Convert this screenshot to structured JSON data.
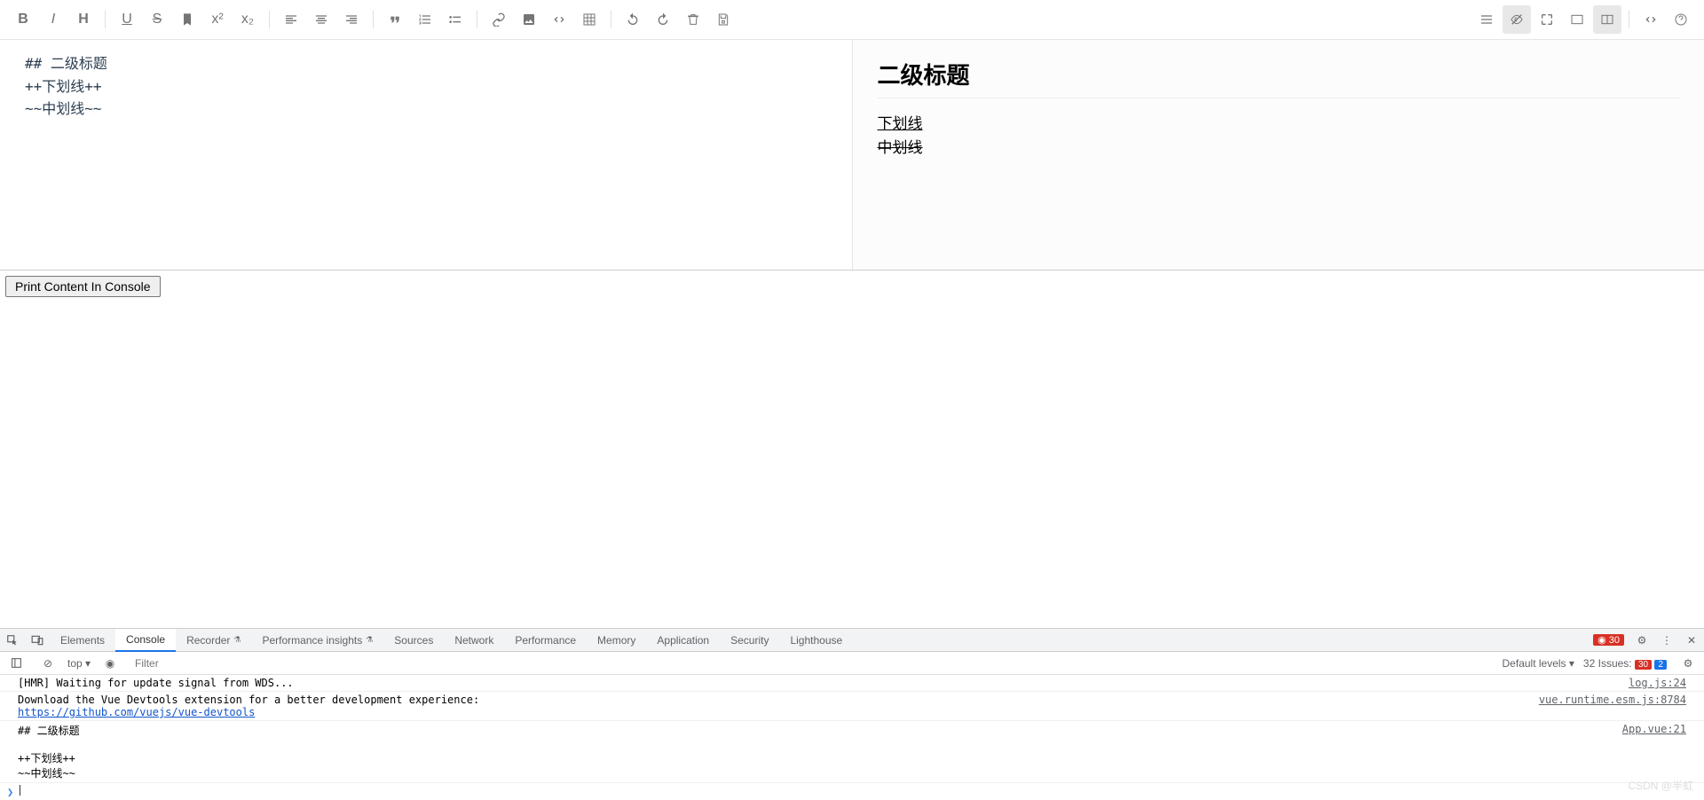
{
  "toolbar": {
    "bold": "B",
    "italic": "I",
    "heading": "H",
    "underline": "U",
    "strike": "S",
    "sup": "x²",
    "sub": "x₂"
  },
  "editor": {
    "line1": "## 二级标题",
    "line2": "",
    "line3": "++下划线++",
    "line4": "~~中划线~~"
  },
  "preview": {
    "heading": "二级标题",
    "underline": "下划线",
    "strike": "中划线"
  },
  "print_button": "Print Content In Console",
  "devtools": {
    "tabs": [
      "Elements",
      "Console",
      "Recorder",
      "Performance insights",
      "Sources",
      "Network",
      "Performance",
      "Memory",
      "Application",
      "Security",
      "Lighthouse"
    ],
    "active_tab": "Console",
    "error_count": "30",
    "filter_placeholder": "Filter",
    "context": "top",
    "levels": "Default levels",
    "issues_label": "32 Issues:",
    "issues_err": "30",
    "issues_info": "2",
    "console": [
      {
        "msg": "[HMR] Waiting for update signal from WDS...",
        "src": "log.js:24"
      },
      {
        "msg": "Download the Vue Devtools extension for a better development experience:",
        "link": "https://github.com/vuejs/vue-devtools",
        "src": "vue.runtime.esm.js:8784"
      },
      {
        "msg": "## 二级标题\n\n++下划线++\n~~中划线~~",
        "src": "App.vue:21"
      }
    ]
  },
  "watermark": "CSDN @半虹"
}
